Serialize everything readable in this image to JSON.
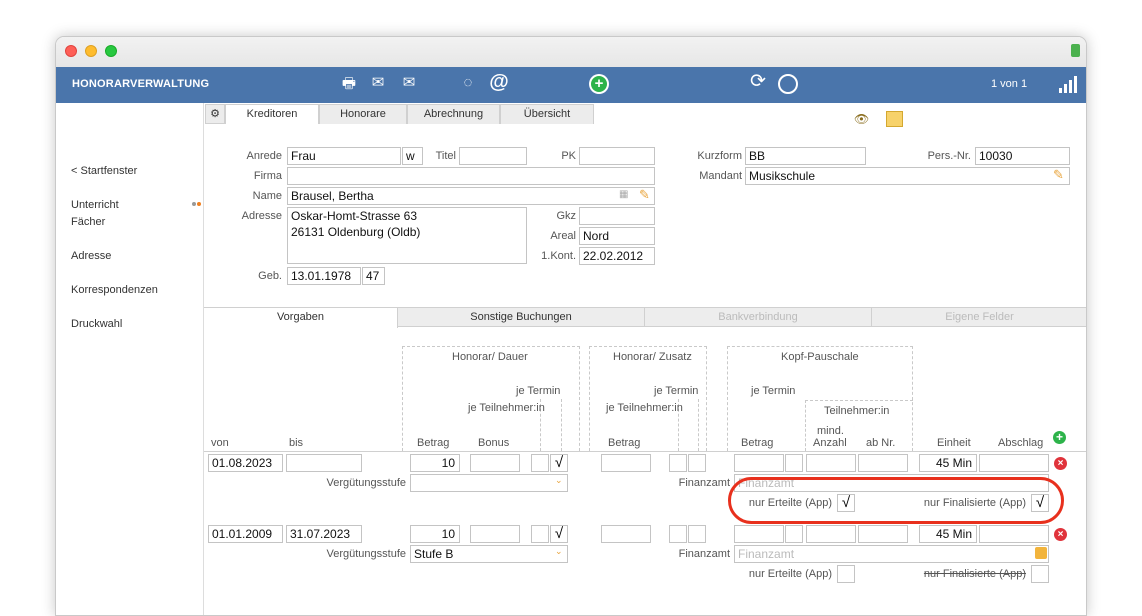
{
  "app": {
    "title": "HONORARVERWALTUNG",
    "record_counter": "1 von 1"
  },
  "sidebar": {
    "items": [
      {
        "label": "< Startfenster"
      },
      {
        "label": "Unterricht"
      },
      {
        "label": "Fächer"
      },
      {
        "label": "Adresse"
      },
      {
        "label": "Korrespondenzen"
      },
      {
        "label": "Druckwahl"
      }
    ]
  },
  "main_tabs": [
    "Kreditoren",
    "Honorare",
    "Abrechnung",
    "Übersicht"
  ],
  "form": {
    "anrede_label": "Anrede",
    "anrede": "Frau",
    "gender": "w",
    "titel_label": "Titel",
    "titel": "",
    "pk_label": "PK",
    "pk": "",
    "firma_label": "Firma",
    "firma": "",
    "name_label": "Name",
    "name": "Brausel, Bertha",
    "adresse_label": "Adresse",
    "adresse_line1": "Oskar-Homt-Strasse 63",
    "adresse_line2": "26131 Oldenburg (Oldb)",
    "gkz_label": "Gkz",
    "gkz": "",
    "areal_label": "Areal",
    "areal": "Nord",
    "kont_label": "1.Kont.",
    "kont": "22.02.2012",
    "geb_label": "Geb.",
    "geb": "13.01.1978",
    "age": "47",
    "kurzform_label": "Kurzform",
    "kurzform": "BB",
    "persnr_label": "Pers.-Nr.",
    "persnr": "10030",
    "mandant_label": "Mandant",
    "mandant": "Musikschule"
  },
  "sub_tabs": [
    "Vorgaben",
    "Sonstige Buchungen",
    "Bankverbindung",
    "Eigene Felder"
  ],
  "headers": {
    "group_dauer": "Honorar/ Dauer",
    "group_zusatz": "Honorar/ Zusatz",
    "group_kopf": "Kopf-Pauschale",
    "je_termin": "je Termin",
    "je_teilnehmer": "je Teilnehmer:in",
    "teilnehmer": "Teilnehmer:in",
    "mind": "mind.",
    "von": "von",
    "bis": "bis",
    "betrag": "Betrag",
    "bonus": "Bonus",
    "anzahl": "Anzahl",
    "ab_nr": "ab Nr.",
    "einheit": "Einheit",
    "abschlag": "Abschlag"
  },
  "labels": {
    "verguetungsstufe": "Vergütungsstufe",
    "finanzamt": "Finanzamt",
    "finanzamt_placeholder": "Finanzamt",
    "nur_erteilte": "nur Erteilte (App)",
    "nur_finalisierte": "nur Finalisierte (App)"
  },
  "rows": [
    {
      "von": "01.08.2023",
      "bis": "",
      "betrag": "10",
      "check": "√",
      "einheit": "45 Min",
      "stufe": "",
      "erteilte": "√",
      "finalisierte": "√"
    },
    {
      "von": "01.01.2009",
      "bis": "31.07.2023",
      "betrag": "10",
      "check": "√",
      "einheit": "45 Min",
      "stufe": "Stufe B",
      "erteilte": "",
      "finalisierte": ""
    }
  ],
  "colors": {
    "toolbar": "#4a75ab",
    "callout": "#e8301d",
    "delete": "#e0333b",
    "add": "#2db34a"
  }
}
